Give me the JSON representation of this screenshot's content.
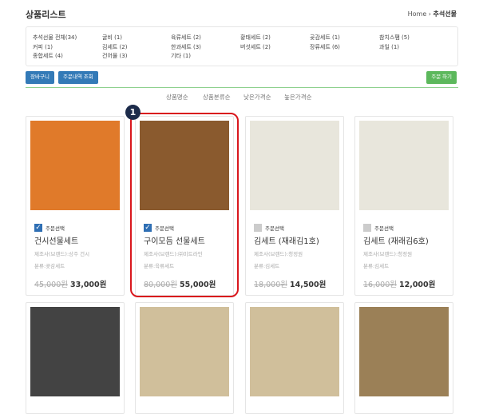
{
  "header": {
    "title": "상품리스트",
    "breadcrumb_home": "Home",
    "breadcrumb_sep": "›",
    "breadcrumb_current": "추석선물"
  },
  "categories": [
    "추석선물 전체(34)",
    "굴비 (1)",
    "육류세트 (2)",
    "황태세트 (2)",
    "곶감세트 (1)",
    "참치스팸 (5)",
    "커피 (1)",
    "김세트 (2)",
    "한과세트 (3)",
    "버섯세트 (2)",
    "장류세트 (6)",
    "과일 (1)",
    "종합세트 (4)",
    "건어물 (3)",
    "기타 (1)"
  ],
  "buttons": {
    "cart": "장바구니",
    "order_history": "주문내역 조회",
    "order": "주문 하기"
  },
  "sort": [
    "상품명순",
    "상품분류순",
    "낮은가격순",
    "높은가격순"
  ],
  "annotation": "1",
  "products": [
    {
      "checked": true,
      "check_label": "주문선택",
      "name": "건시선물세트",
      "maker": "제조사(브랜드):상주 건시",
      "category": "분류:곶감세트",
      "old_price": "45,000원",
      "price": "33,000원",
      "color": "#e07a2a"
    },
    {
      "checked": true,
      "check_label": "주문선택",
      "name": "구이모듬 선물세트",
      "maker": "제조사(브랜드):㈜미트라인",
      "category": "분류:육류세트",
      "old_price": "80,000원",
      "price": "55,000원",
      "color": "#8a5a2e"
    },
    {
      "checked": false,
      "check_label": "주문선택",
      "name": "김세트 (재래김1호)",
      "maker": "제조사(브랜드):청정원",
      "category": "분류:김세트",
      "old_price": "18,000원",
      "price": "14,500원",
      "color": "#e8e6dc"
    },
    {
      "checked": false,
      "check_label": "주문선택",
      "name": "김세트 (재래김6호)",
      "maker": "제조사(브랜드):청정원",
      "category": "분류:김세트",
      "old_price": "16,000원",
      "price": "12,000원",
      "color": "#e8e6dc"
    }
  ],
  "row2_colors": [
    "#222222",
    "#c8b48a",
    "#c8b48a",
    "#8a6a3a"
  ]
}
